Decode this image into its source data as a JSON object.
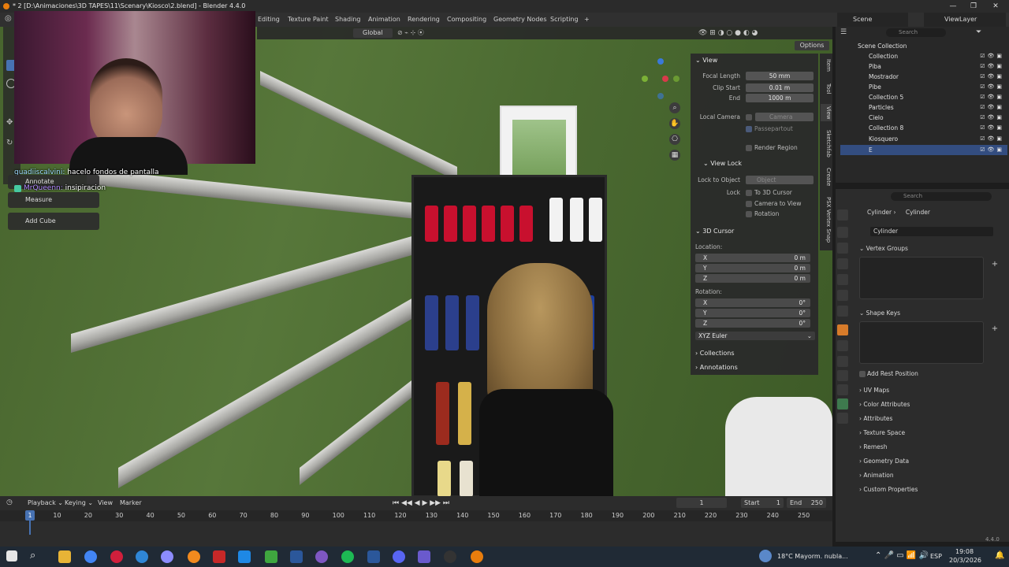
{
  "window": {
    "title": "* 2 [D:\\Animaciones\\3D TAPES\\11\\Scenary\\Kiosco\\2.blend] - Blender 4.4.0",
    "controls": [
      "—",
      "❐",
      "✕"
    ]
  },
  "workspaces": [
    "Editing",
    "Texture Paint",
    "Shading",
    "Animation",
    "Rendering",
    "Compositing",
    "Geometry Nodes",
    "Scripting",
    "+"
  ],
  "scene": {
    "name": "Scene",
    "view_layer": "ViewLayer"
  },
  "viewport_header": {
    "orientation": "Global",
    "options_label": "Options"
  },
  "chat": [
    {
      "user": "guadiiscalvini:",
      "message": "hacelo fondos de pantalla",
      "user_color": "#9fd9ff"
    },
    {
      "user": "MrQueenn:",
      "message": "insipiracion",
      "user_color": "#b38bff"
    }
  ],
  "tool_popups": [
    "Annotate",
    "Measure",
    "Add Cube"
  ],
  "npanel": {
    "view_header": "View",
    "focal_length_label": "Focal Length",
    "focal_length": "50 mm",
    "clip_start_label": "Clip Start",
    "clip_start": "0.01 m",
    "clip_end_label": "End",
    "clip_end": "1000 m",
    "local_camera_label": "Local Camera",
    "camera_placeholder": "Camera",
    "passepartout": "Passepartout",
    "render_region": "Render Region",
    "view_lock_header": "View Lock",
    "lock_to_object_label": "Lock to Object",
    "object_placeholder": "Object",
    "lock_label": "Lock",
    "to_3d_cursor": "To 3D Cursor",
    "camera_to_view": "Camera to View",
    "rotation_lock": "Rotation",
    "cursor_header": "3D Cursor",
    "location_label": "Location:",
    "loc_x": "0 m",
    "loc_y": "0 m",
    "loc_z": "0 m",
    "rotation_label": "Rotation:",
    "rot_x": "0°",
    "rot_y": "0°",
    "rot_z": "0°",
    "x": "X",
    "y": "Y",
    "z": "Z",
    "rotation_mode": "XYZ Euler",
    "collections": "Collections",
    "annotations": "Annotations"
  },
  "ntabs": [
    "Item",
    "Tool",
    "View",
    "Sketchfab",
    "Create",
    "PSX Vertex Snap"
  ],
  "outliner": {
    "search_placeholder": "Search",
    "root": "Scene Collection",
    "items": [
      "Collection",
      "Piba",
      "Mostrador",
      "Pibe",
      "Collection 5",
      "Particles",
      "Cielo",
      "Collection 8",
      "Kiosquero",
      "E"
    ]
  },
  "properties": {
    "search_placeholder": "Search",
    "breadcrumb_object": "Cylinder",
    "breadcrumb_data": "Cylinder",
    "mesh_name": "Cylinder",
    "panels": [
      "Vertex Groups",
      "Shape Keys",
      "Add Rest Position",
      "UV Maps",
      "Color Attributes",
      "Attributes",
      "Texture Space",
      "Remesh",
      "Geometry Data",
      "Animation",
      "Custom Properties"
    ]
  },
  "timeline": {
    "menus": [
      "Playback",
      "Keying",
      "View",
      "Marker"
    ],
    "current_frame": "1",
    "start_label": "Start",
    "start": "1",
    "end_label": "End",
    "end": "250",
    "ticks": [
      "1",
      "10",
      "20",
      "30",
      "40",
      "50",
      "60",
      "70",
      "80",
      "90",
      "100",
      "110",
      "120",
      "130",
      "140",
      "150",
      "160",
      "170",
      "180",
      "190",
      "200",
      "210",
      "220",
      "230",
      "240",
      "250"
    ]
  },
  "version": "4.4.0",
  "taskbar": {
    "weather": "18°C  Mayorm. nubla...",
    "language": "ESP",
    "time": "19:08",
    "date": "20/3/2026"
  }
}
